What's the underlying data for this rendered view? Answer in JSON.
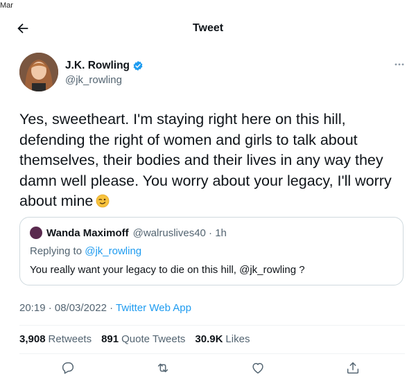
{
  "corner_label": "Mar",
  "header": {
    "title": "Tweet"
  },
  "author": {
    "name": "J.K. Rowling",
    "handle": "@jk_rowling"
  },
  "tweet": {
    "text": "Yes, sweetheart. I'm staying right here on this hill, defending the right of women and girls to talk about themselves, their bodies and their lives in any way they damn well please. You worry about your legacy, I'll worry about mine"
  },
  "quote": {
    "name": "Wanda Maximoff",
    "handle_time": "@walruslives40 · 1h",
    "replying_prefix": "Replying to",
    "replying_handle": "@jk_rowling",
    "text": "You really want your legacy to die on this hill, @jk_rowling ?"
  },
  "meta": {
    "time_date": "20:19 · 08/03/2022 · ",
    "source": "Twitter Web App"
  },
  "stats": {
    "retweets_count": "3,908",
    "retweets_label": "Retweets",
    "quotes_count": "891",
    "quotes_label": "Quote Tweets",
    "likes_count": "30.9K",
    "likes_label": "Likes"
  },
  "colors": {
    "accent": "#1d9bf0",
    "secondary_text": "#536471",
    "border": "#cfd9de"
  }
}
